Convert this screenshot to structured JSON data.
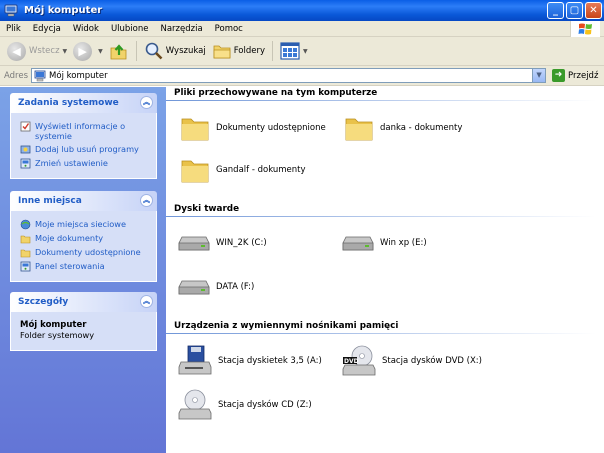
{
  "window": {
    "title": "Mój komputer"
  },
  "menu": [
    "Plik",
    "Edycja",
    "Widok",
    "Ulubione",
    "Narzędzia",
    "Pomoc"
  ],
  "toolbar": {
    "back_label": "Wstecz",
    "search_label": "Wyszukaj",
    "folders_label": "Foldery"
  },
  "address": {
    "label": "Adres",
    "value": "Mój komputer",
    "go_label": "Przejdź"
  },
  "taskpane": {
    "system_tasks": {
      "title": "Zadania systemowe",
      "items": [
        "Wyświetl informacje o systemie",
        "Dodaj lub usuń programy",
        "Zmień ustawienie"
      ]
    },
    "other_places": {
      "title": "Inne miejsca",
      "items": [
        "Moje miejsca sieciowe",
        "Moje dokumenty",
        "Dokumenty udostępnione",
        "Panel sterowania"
      ]
    },
    "details": {
      "title": "Szczegóły",
      "name": "Mój komputer",
      "type": "Folder systemowy"
    }
  },
  "groups": {
    "stored_files": {
      "title": "Pliki przechowywane na tym komputerze",
      "items": [
        "Dokumenty udostępnione",
        "danka - dokumenty",
        "Gandalf - dokumenty"
      ]
    },
    "hard_disks": {
      "title": "Dyski twarde",
      "items": [
        "WIN_2K (C:)",
        "Win xp (E:)",
        "DATA (F:)"
      ]
    },
    "removable": {
      "title": "Urządzenia z wymiennymi nośnikami pamięci",
      "items": [
        "Stacja dyskietek 3,5 (A:)",
        "Stacja dysków DVD (X:)",
        "Stacja dysków CD (Z:)"
      ]
    }
  }
}
